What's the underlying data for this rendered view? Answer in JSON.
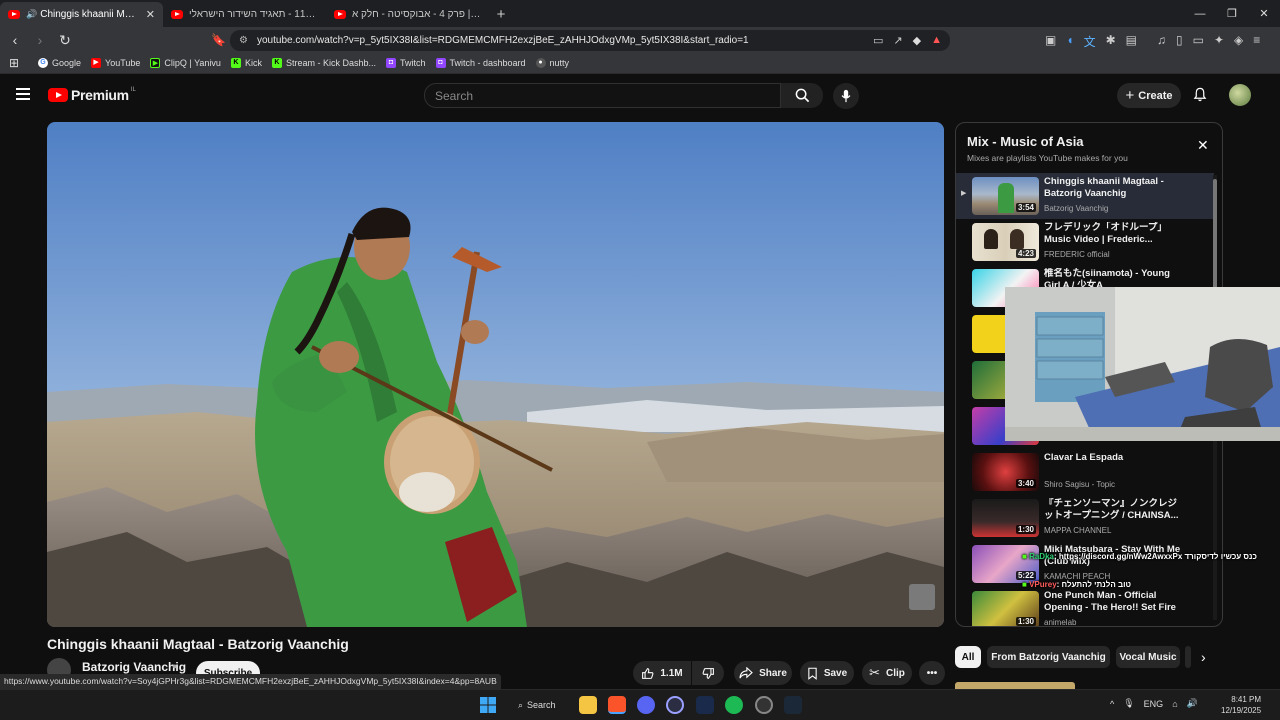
{
  "browser": {
    "tabs": [
      {
        "label": "Chinggis khaanii Magtaal - B",
        "active": true,
        "audio": true
      },
      {
        "label": "כאן 11 - תאגיד השידור הישראלי - ube"
      },
      {
        "label": "יקומות | פרק 4 - אבוקסיטה - חלק א"
      }
    ],
    "url": "youtube.com/watch?v=p_5yt5IX38I&list=RDGMEMCMFH2exzjBeE_zAHHJOdxgVMp_5yt5IX38I&start_radio=1",
    "bookmarks": [
      "Google",
      "YouTube",
      "ClipQ | Yanivu",
      "Kick",
      "Stream - Kick Dashb...",
      "Twitch",
      "Twitch - dashboard",
      "nutty"
    ],
    "status_url": "https://www.youtube.com/watch?v=Soy4jGPHr3g&list=RDGMEMCMFH2exzjBeE_zAHHJOdxgVMp_5yt5IX38I&index=4&pp=8AUB"
  },
  "youtube": {
    "logo_word": "Premium",
    "logo_country": "IL",
    "search_placeholder": "Search",
    "create_label": "Create"
  },
  "video": {
    "title": "Chinggis khaanii Magtaal - Batzorig Vaanchig",
    "channel": "Batzorig Vaanchig",
    "subscribe_label": "Subscribe",
    "likes": "1.1M",
    "share_label": "Share",
    "save_label": "Save",
    "clip_label": "Clip"
  },
  "playlist": {
    "title": "Mix - Music of Asia",
    "subtitle": "Mixes are playlists YouTube makes for you",
    "items": [
      {
        "title": "Chinggis khaanii Magtaal - Batzorig Vaanchig",
        "channel": "Batzorig Vaanchig",
        "duration": "3:54",
        "current": true
      },
      {
        "title": "フレデリック「オドループ」Music Video | Frederic...",
        "channel": "FREDERIC official",
        "duration": "4:23"
      },
      {
        "title": "椎名もた(siinamota) - Young Girl A / 少女A",
        "channel": "",
        "duration": ""
      },
      {
        "title": "",
        "channel": "",
        "duration": ""
      },
      {
        "title": "",
        "channel": "",
        "duration": ""
      },
      {
        "title": "",
        "channel": "",
        "duration": ""
      },
      {
        "title": "Clavar La Espada",
        "channel": "Shiro Sagisu - Topic",
        "duration": "3:40"
      },
      {
        "title": "『チェンソーマン』ノンクレジットオープニング / CHAINSA...",
        "channel": "MAPPA CHANNEL",
        "duration": "1:30"
      },
      {
        "title": "Miki Matsubara - Stay With Me (Club Mix)",
        "channel": "KAMACHI PEACH",
        "duration": "5:22"
      },
      {
        "title": "One Punch Man - Official Opening - The Hero!! Set Fire ...",
        "channel": "animelab",
        "duration": "1:30"
      }
    ],
    "chips": [
      "All",
      "From Batzorig Vaanchig",
      "Vocal Music"
    ]
  },
  "overlay_chat": [
    {
      "user": "RaDka",
      "text": ": https://discord.gg/nWw2AwxxPx כנס עכשיו לדיסקורד"
    },
    {
      "user": "VPurey",
      "text": ": טוב הלנתי להתעלח"
    }
  ],
  "taskbar": {
    "search_label": "Search",
    "language": "ENG",
    "time": "8:41 PM",
    "date": "12/19/2025"
  },
  "colors": {
    "yt_red": "#ff0000",
    "bg": "#0f0f0f",
    "current_item": "#272c38"
  }
}
